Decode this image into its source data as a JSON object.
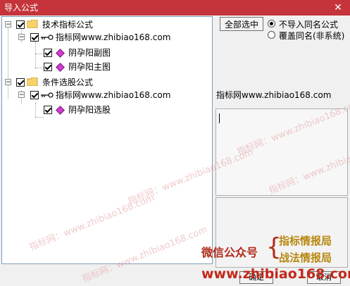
{
  "window": {
    "title": "导入公式",
    "close_glyph": "✕"
  },
  "tree": {
    "nodes": [
      {
        "label": "技术指标公式",
        "icon": "folder-icon",
        "expand": "−"
      },
      {
        "label": "指标网www.zhibiao168.com",
        "icon": "key-icon",
        "expand": "−"
      },
      {
        "label": "阴孕阳副图",
        "icon": "formula-diamond-icon"
      },
      {
        "label": "阴孕阳主图",
        "icon": "formula-diamond-icon"
      },
      {
        "label": "条件选股公式",
        "icon": "folder-icon",
        "expand": "−"
      },
      {
        "label": "指标网www.zhibiao168.com",
        "icon": "key-icon",
        "expand": "−"
      },
      {
        "label": "阴孕阳选股",
        "icon": "formula-diamond-icon"
      }
    ]
  },
  "buttons": {
    "select_all": "全部选中",
    "ok": "确定",
    "cancel": "取消"
  },
  "options": {
    "no_import_same": "不导入同名公式",
    "overwrite_same": "覆盖同名(非系统)",
    "selected": "no_import_same"
  },
  "detail": {
    "author": "指标网www.zhibiao168.com"
  },
  "watermark": {
    "text": "指标网：www.zhibiao168.com"
  },
  "ad": {
    "wechat": "微信公众号",
    "line1": "指标情报局",
    "line2": "战法情报局",
    "url": "www.zhibiao168.com"
  },
  "colors": {
    "titlebar": "#c4343a",
    "ad_red": "#b22a1a",
    "ad_gold": "#b8870f"
  }
}
